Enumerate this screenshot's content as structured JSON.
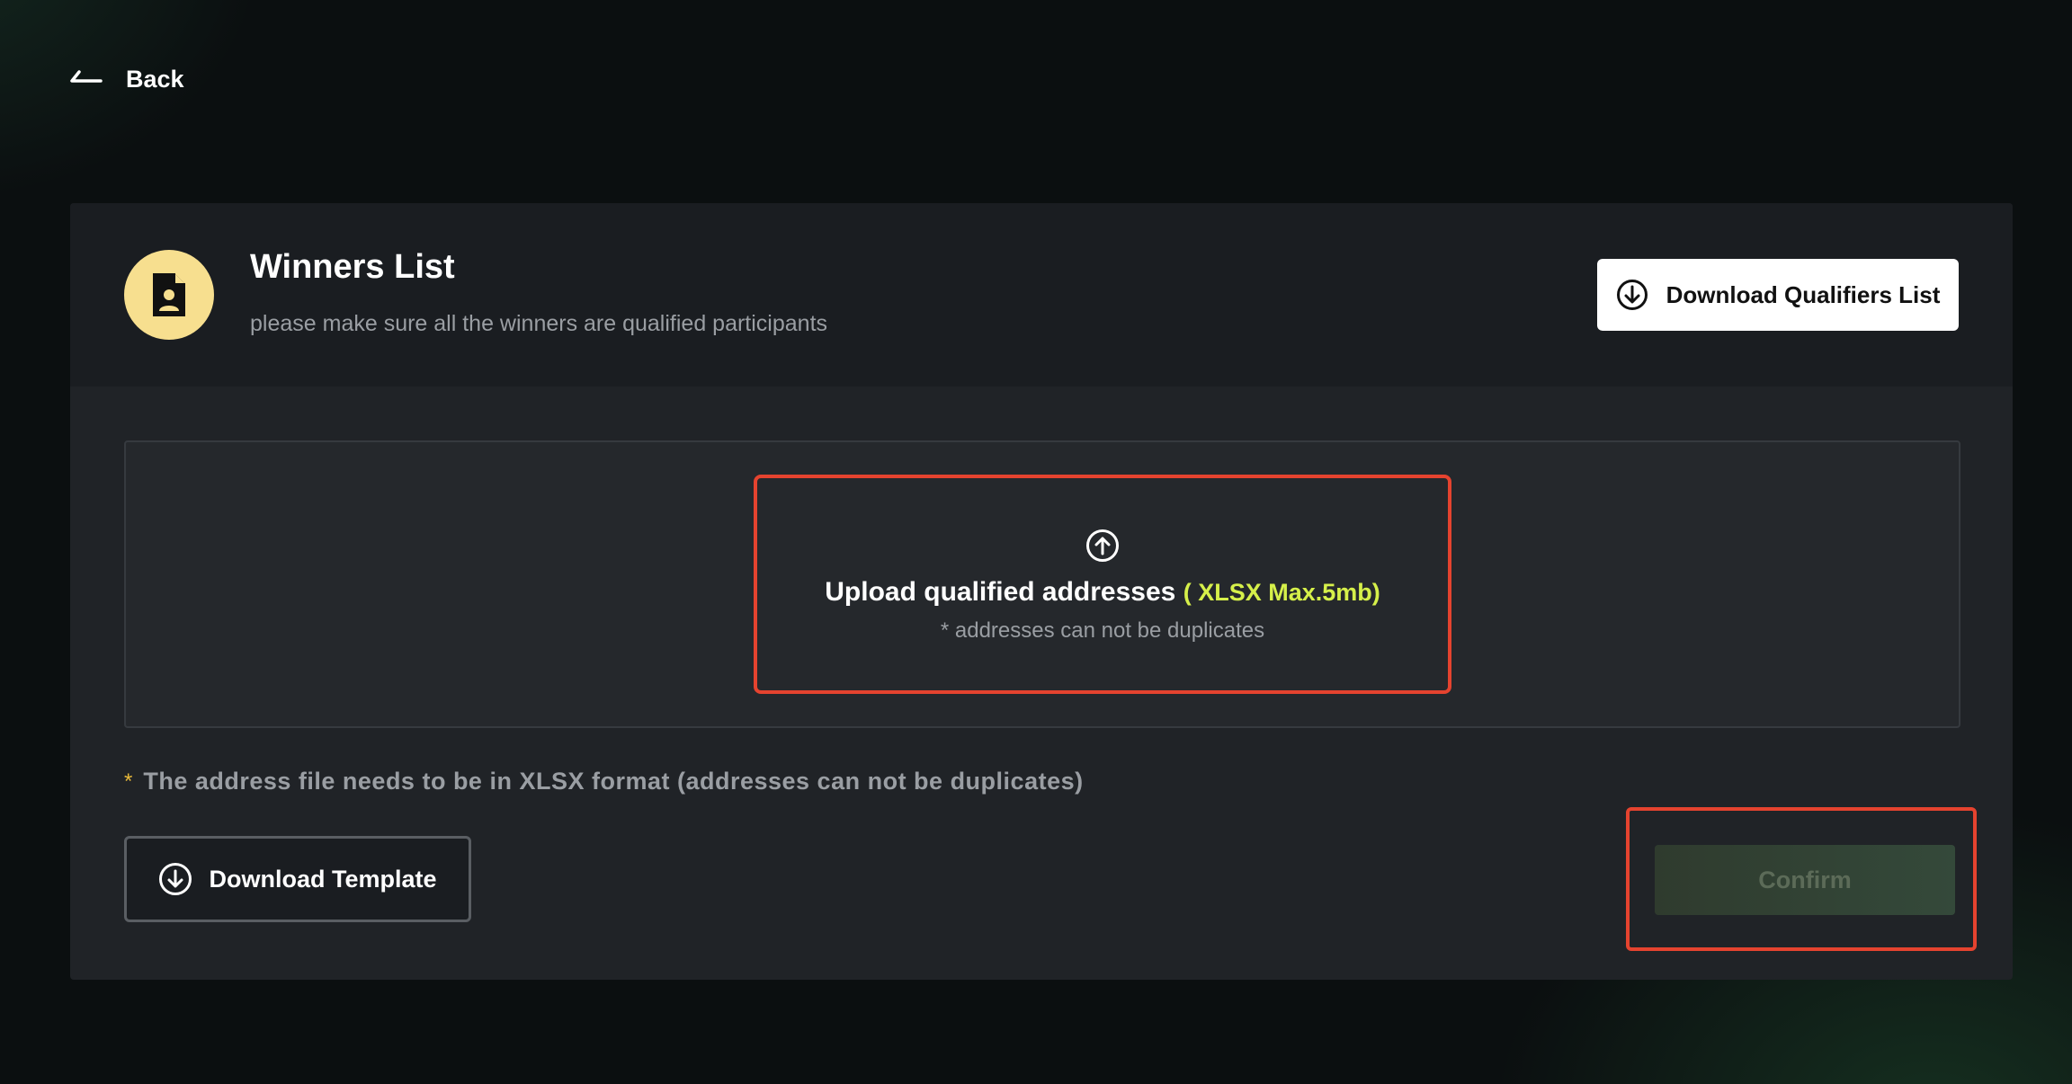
{
  "nav": {
    "back_label": "Back",
    "back_icon": "arrow-left-icon"
  },
  "header": {
    "title": "Winners List",
    "subtitle": "please make sure all the winners are qualified participants",
    "avatar_icon": "document-user-icon",
    "download_qualifiers_label": "Download Qualifiers List",
    "download_icon": "download-circle-icon"
  },
  "upload": {
    "icon": "upload-circle-icon",
    "title": "Upload qualified addresses",
    "format_label": "( XLSX Max.5mb)",
    "hint": "* addresses can not be duplicates"
  },
  "note": {
    "marker": "*",
    "text": "The address file needs to be in XLSX format (addresses can not be duplicates)"
  },
  "actions": {
    "download_template_label": "Download Template",
    "confirm_label": "Confirm",
    "confirm_enabled": false
  },
  "colors": {
    "background": "#0b0f10",
    "card": "#202327",
    "card_header": "#1a1d21",
    "accent_yellow": "#f7df8f",
    "format_highlight": "#d6f04a",
    "annotation_red": "#e5432f",
    "confirm_disabled": "#34493a"
  }
}
